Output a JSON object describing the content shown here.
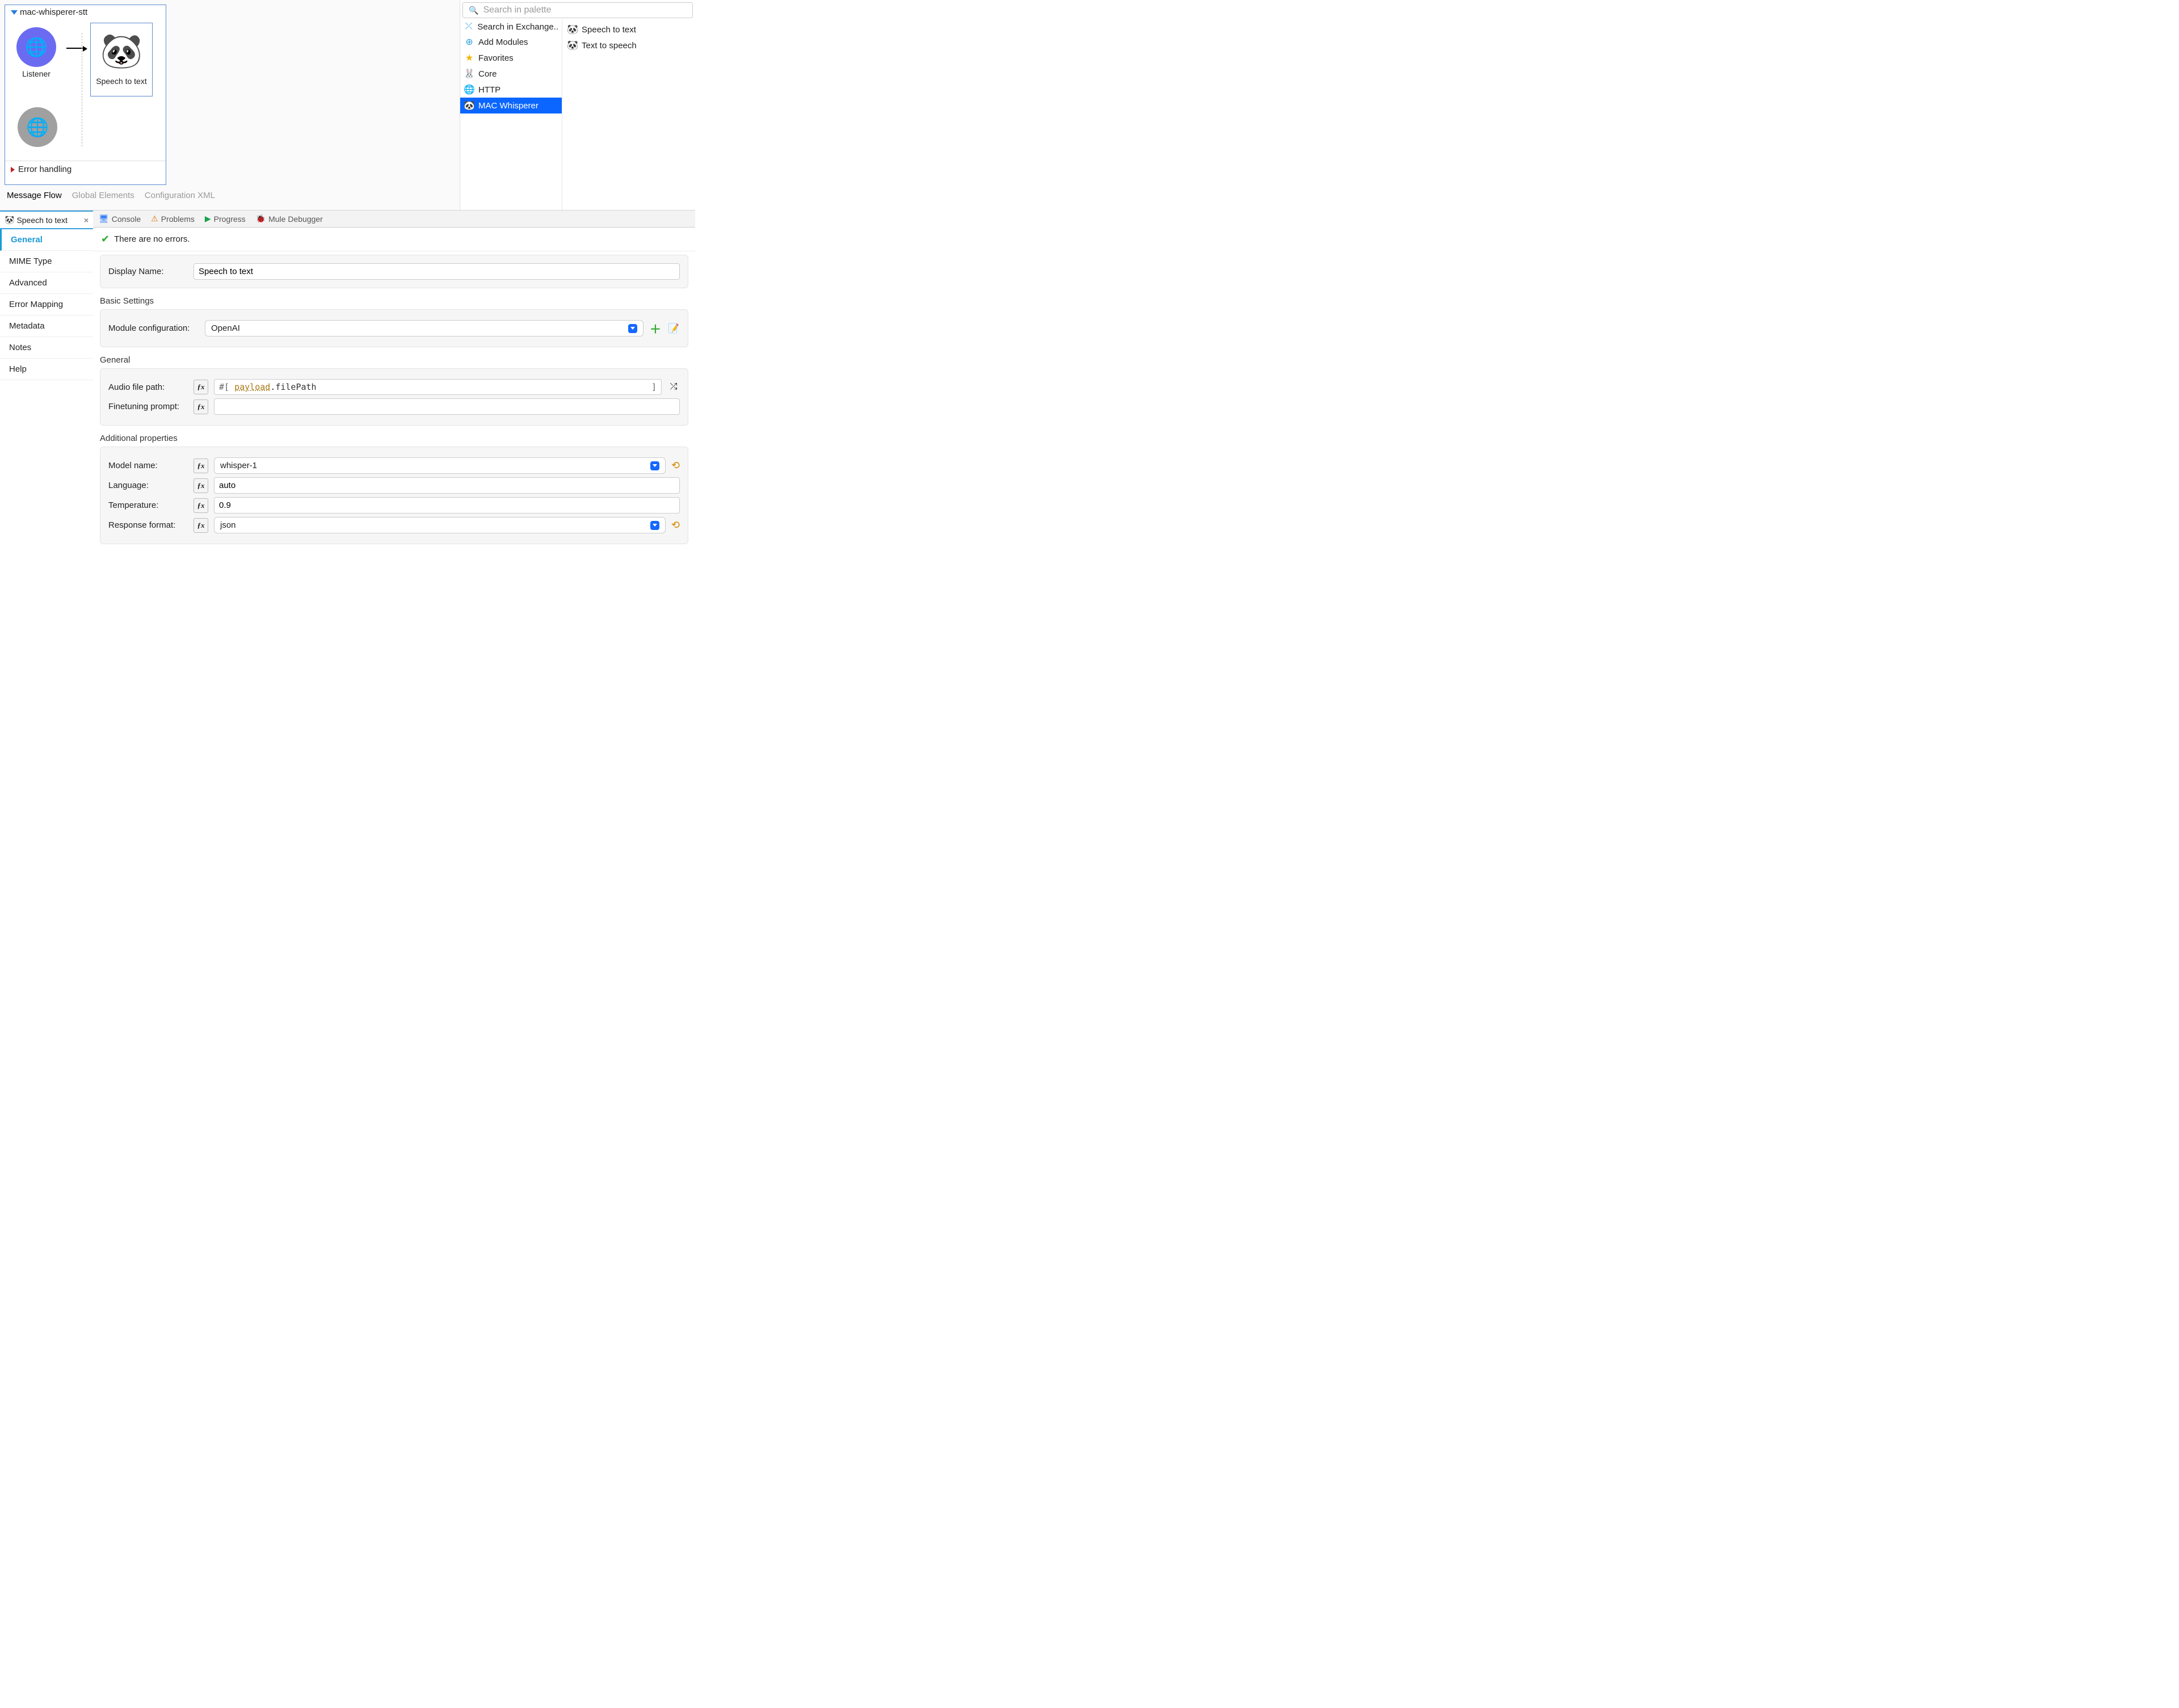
{
  "flow": {
    "name": "mac-whisperer-stt",
    "listener_label": "Listener",
    "processor_label": "Speech to text",
    "error_footer": "Error handling"
  },
  "canvas_tabs": {
    "message_flow": "Message Flow",
    "global_elements": "Global Elements",
    "config_xml": "Configuration XML"
  },
  "palette": {
    "search_placeholder": "Search in palette",
    "categories": {
      "exchange": "Search in Exchange..",
      "add_modules": "Add Modules",
      "favorites": "Favorites",
      "core": "Core",
      "http": "HTTP",
      "mac_whisperer": "MAC Whisperer"
    },
    "items": {
      "speech_to_text": "Speech to text",
      "text_to_speech": "Text to speech"
    }
  },
  "bottom_tabs": {
    "console": "Console",
    "problems": "Problems",
    "progress": "Progress",
    "mule_debugger": "Mule Debugger"
  },
  "props": {
    "editor_tab_title": "Speech to text",
    "side_tabs": {
      "general": "General",
      "mime": "MIME Type",
      "advanced": "Advanced",
      "error_mapping": "Error Mapping",
      "metadata": "Metadata",
      "notes": "Notes",
      "help": "Help"
    },
    "status": "There are no errors.",
    "display_name": {
      "label": "Display Name:",
      "value": "Speech to text"
    },
    "sections": {
      "basic": "Basic Settings",
      "general": "General",
      "additional": "Additional properties"
    },
    "module_config": {
      "label": "Module configuration:",
      "value": "OpenAI"
    },
    "audio_path": {
      "label": "Audio file path:",
      "prefix": "#[ ",
      "kw": "payload",
      "rest": ".filePath",
      "suffix": " ]"
    },
    "finetune": {
      "label": "Finetuning prompt:",
      "value": ""
    },
    "model_name": {
      "label": "Model name:",
      "value": "whisper-1"
    },
    "language": {
      "label": "Language:",
      "value": "auto"
    },
    "temperature": {
      "label": "Temperature:",
      "value": "0.9"
    },
    "response_format": {
      "label": "Response format:",
      "value": "json"
    }
  }
}
